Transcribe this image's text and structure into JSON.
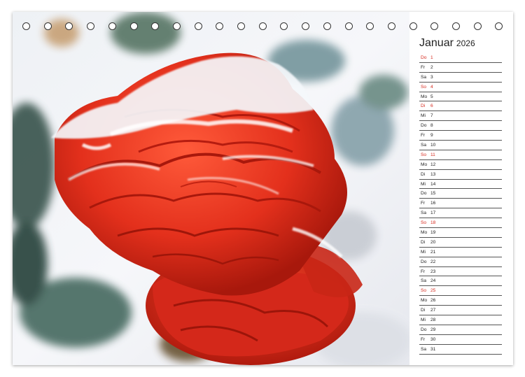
{
  "calendar": {
    "month": "Januar",
    "year": "2026",
    "days": [
      {
        "wd": "Do",
        "d": "1",
        "hi": true
      },
      {
        "wd": "Fr",
        "d": "2",
        "hi": false
      },
      {
        "wd": "Sa",
        "d": "3",
        "hi": false
      },
      {
        "wd": "So",
        "d": "4",
        "hi": true
      },
      {
        "wd": "Mo",
        "d": "5",
        "hi": false
      },
      {
        "wd": "Di",
        "d": "6",
        "hi": true
      },
      {
        "wd": "Mi",
        "d": "7",
        "hi": false
      },
      {
        "wd": "Do",
        "d": "8",
        "hi": false
      },
      {
        "wd": "Fr",
        "d": "9",
        "hi": false
      },
      {
        "wd": "Sa",
        "d": "10",
        "hi": false
      },
      {
        "wd": "So",
        "d": "11",
        "hi": true
      },
      {
        "wd": "Mo",
        "d": "12",
        "hi": false
      },
      {
        "wd": "Di",
        "d": "13",
        "hi": false
      },
      {
        "wd": "Mi",
        "d": "14",
        "hi": false
      },
      {
        "wd": "Do",
        "d": "15",
        "hi": false
      },
      {
        "wd": "Fr",
        "d": "16",
        "hi": false
      },
      {
        "wd": "Sa",
        "d": "17",
        "hi": false
      },
      {
        "wd": "So",
        "d": "18",
        "hi": true
      },
      {
        "wd": "Mo",
        "d": "19",
        "hi": false
      },
      {
        "wd": "Di",
        "d": "20",
        "hi": false
      },
      {
        "wd": "Mi",
        "d": "21",
        "hi": false
      },
      {
        "wd": "Do",
        "d": "22",
        "hi": false
      },
      {
        "wd": "Fr",
        "d": "23",
        "hi": false
      },
      {
        "wd": "Sa",
        "d": "24",
        "hi": false
      },
      {
        "wd": "So",
        "d": "25",
        "hi": true
      },
      {
        "wd": "Mo",
        "d": "26",
        "hi": false
      },
      {
        "wd": "Di",
        "d": "27",
        "hi": false
      },
      {
        "wd": "Mi",
        "d": "28",
        "hi": false
      },
      {
        "wd": "Do",
        "d": "29",
        "hi": false
      },
      {
        "wd": "Fr",
        "d": "30",
        "hi": false
      },
      {
        "wd": "Sa",
        "d": "31",
        "hi": false
      }
    ]
  },
  "colors": {
    "holiday": "#d62a1e",
    "rose": "#e8321e",
    "rose_dark": "#b81c10",
    "frost": "#f4f7fb",
    "leaf": "#5f7f78"
  }
}
